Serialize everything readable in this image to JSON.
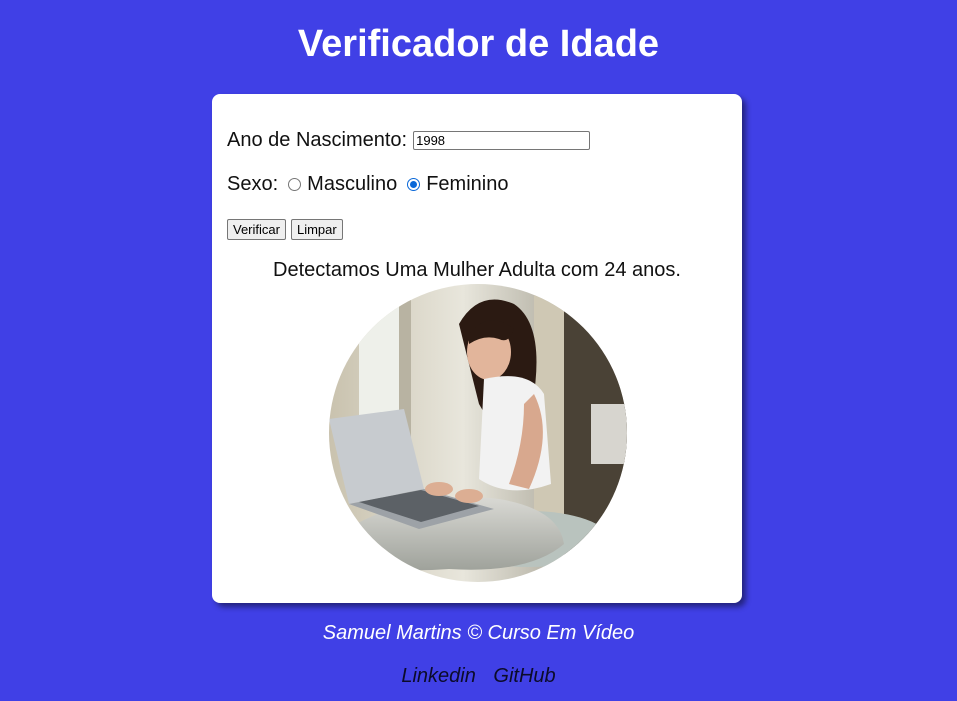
{
  "header": {
    "title": "Verificador de Idade"
  },
  "form": {
    "birth_label": "Ano de Nascimento:",
    "birth_value": "1998",
    "sex_label": "Sexo:",
    "sex_options": [
      {
        "label": "Masculino",
        "checked": false
      },
      {
        "label": "Feminino",
        "checked": true
      }
    ],
    "verify_button": "Verificar",
    "clear_button": "Limpar"
  },
  "result": {
    "text": "Detectamos Uma Mulher Adulta com 24 anos.",
    "image_icon": "woman-photo"
  },
  "footer": {
    "credit": "Samuel Martins © Curso Em Vídeo",
    "links": [
      "Linkedin",
      "GitHub"
    ]
  },
  "colors": {
    "background": "#4040e6",
    "card": "#ffffff",
    "radio_accent": "#0a68d8"
  }
}
